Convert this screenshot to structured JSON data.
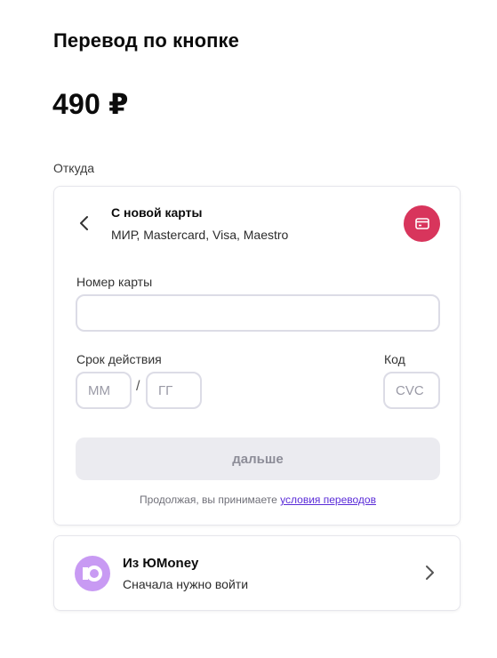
{
  "header": {
    "title": "Перевод по кнопке",
    "amount": "490 ₽"
  },
  "from": {
    "label": "Откуда"
  },
  "card_method": {
    "title": "С новой карты",
    "subtitle": "МИР, Mastercard, Visa, Maestro",
    "badge_icon": "credit-card-icon",
    "badge_color": "#d8355c"
  },
  "form": {
    "card_number_label": "Номер карты",
    "card_number_value": "",
    "expiry_label": "Срок действия",
    "month_placeholder": "ММ",
    "year_placeholder": "ГГ",
    "separator": "/",
    "code_label": "Код",
    "cvc_placeholder": "CVC",
    "next_label": "дальше",
    "terms_prefix": "Продолжая, вы принимаете ",
    "terms_link": "условия переводов"
  },
  "wallet": {
    "title": "Из ЮMoney",
    "subtitle": "Сначала нужно войти",
    "logo_color": "#c89af3"
  }
}
